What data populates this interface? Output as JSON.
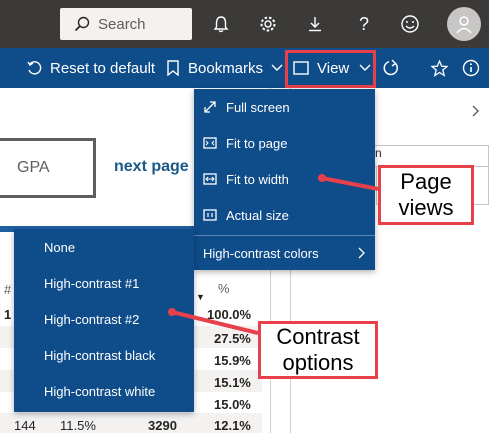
{
  "topbar": {
    "search_placeholder": "Search",
    "icons": [
      "search-icon",
      "bell-icon",
      "gear-icon",
      "download-icon",
      "help-icon",
      "smiley-icon",
      "user-avatar-icon"
    ]
  },
  "cmdbar": {
    "reset_label": "Reset to default",
    "bookmarks_label": "Bookmarks",
    "view_label": "View"
  },
  "canvas": {
    "gpa_label": "GPA",
    "next_page_label": "next page",
    "table": {
      "header_hash": "#",
      "header_pct": "%",
      "row_first": "1",
      "pct_values": [
        "100.0%",
        "27.5%",
        "15.9%",
        "15.1%",
        "15.0%",
        "12.1%"
      ],
      "last_row": [
        "144",
        "11.5%",
        "3290",
        "12.1%"
      ]
    },
    "right_input_value": "n"
  },
  "view_menu": {
    "items": [
      "Full screen",
      "Fit to page",
      "Fit to width",
      "Actual size"
    ],
    "contrast_label": "High-contrast colors"
  },
  "contrast_menu": {
    "items": [
      "None",
      "High-contrast #1",
      "High-contrast #2",
      "High-contrast black",
      "High-contrast white"
    ]
  },
  "callouts": {
    "page_views": "Page views",
    "contrast_options": "Contrast options"
  },
  "colors": {
    "topbar": "#3b3a39",
    "cmdbar": "#0f4c8a",
    "menu": "#0f4c8a",
    "callout_border": "#e8404a"
  }
}
